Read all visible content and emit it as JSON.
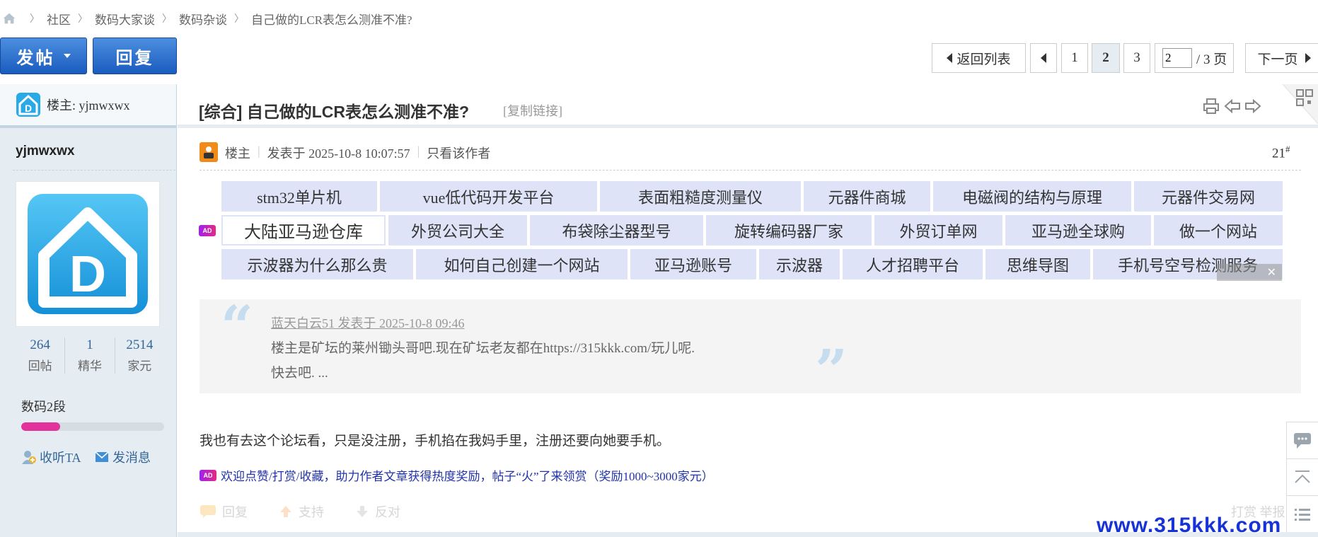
{
  "breadcrumb": {
    "items": [
      "社区",
      "数码大家谈",
      "数码杂谈",
      "自己做的LCR表怎么测准不准?"
    ]
  },
  "toolbar": {
    "post_label": "发帖",
    "reply_label": "回复"
  },
  "pager": {
    "back_label": "返回列表",
    "pages": [
      "1",
      "2",
      "3"
    ],
    "current_page": "2",
    "page_input_value": "2",
    "total_label": "/ 3 页",
    "next_label": "下一页"
  },
  "sidebar": {
    "owner_label": "楼主: yjmwxwx",
    "author_name": "yjmwxwx",
    "stats": [
      {
        "num": "264",
        "label": "回帖"
      },
      {
        "num": "1",
        "label": "精华"
      },
      {
        "num": "2514",
        "label": "家元"
      }
    ],
    "rank": "数码2段",
    "rank_progress": 0.27,
    "follow_label": "收听TA",
    "message_label": "发消息"
  },
  "thread": {
    "title": "[综合] 自己做的LCR表怎么测准不准?",
    "copy_link": "[复制链接]"
  },
  "post": {
    "owner_tag": "楼主",
    "posted_at": "发表于 2025-10-8 10:07:57",
    "only_author": "只看该作者",
    "floor": "21",
    "floor_mark": "#",
    "ad_badge": "AD",
    "ad_tags": [
      "stm32单片机",
      "vue低代码开发平台",
      "表面粗糙度测量仪",
      "元器件商城",
      "电磁阀的结构与原理",
      "元器件交易网",
      "大陆亚马逊仓库",
      "外贸公司大全",
      "布袋除尘器型号",
      "旋转编码器厂家",
      "外贸订单网",
      "亚马逊全球购",
      "做一个网站",
      "示波器为什么那么贵",
      "如何自己创建一个网站",
      "亚马逊账号",
      "示波器",
      "人才招聘平台",
      "思维导图",
      "手机号空号检测服务"
    ],
    "quote_by": "蓝天白云51 发表于 2025-10-8 09:46",
    "quote_line1": "楼主是矿坛的莱州锄头哥吧.现在矿坛老友都在https://315kkk.com/玩儿呢.",
    "quote_line2": "快去吧. ...",
    "body": "我也有去这个论坛看，只是没注册，手机掐在我妈手里，注册还要向她要手机。",
    "promo": "欢迎点赞/打赏/收藏，助力作者文章获得热度奖励，帖子“火”了来领赏（奖励1000~3000家元）",
    "actions": [
      "回复",
      "支持",
      "反对"
    ],
    "actions_right": "打赏  举报"
  },
  "watermark": "www.315kkk.com",
  "colors": {
    "accent_blue": "#1a5bbd",
    "sidebar_bg": "#e5edf2",
    "ad_tag_bg": "#dee3f8",
    "rank_fill": "#e1339b",
    "watermark": "#1733d6"
  }
}
